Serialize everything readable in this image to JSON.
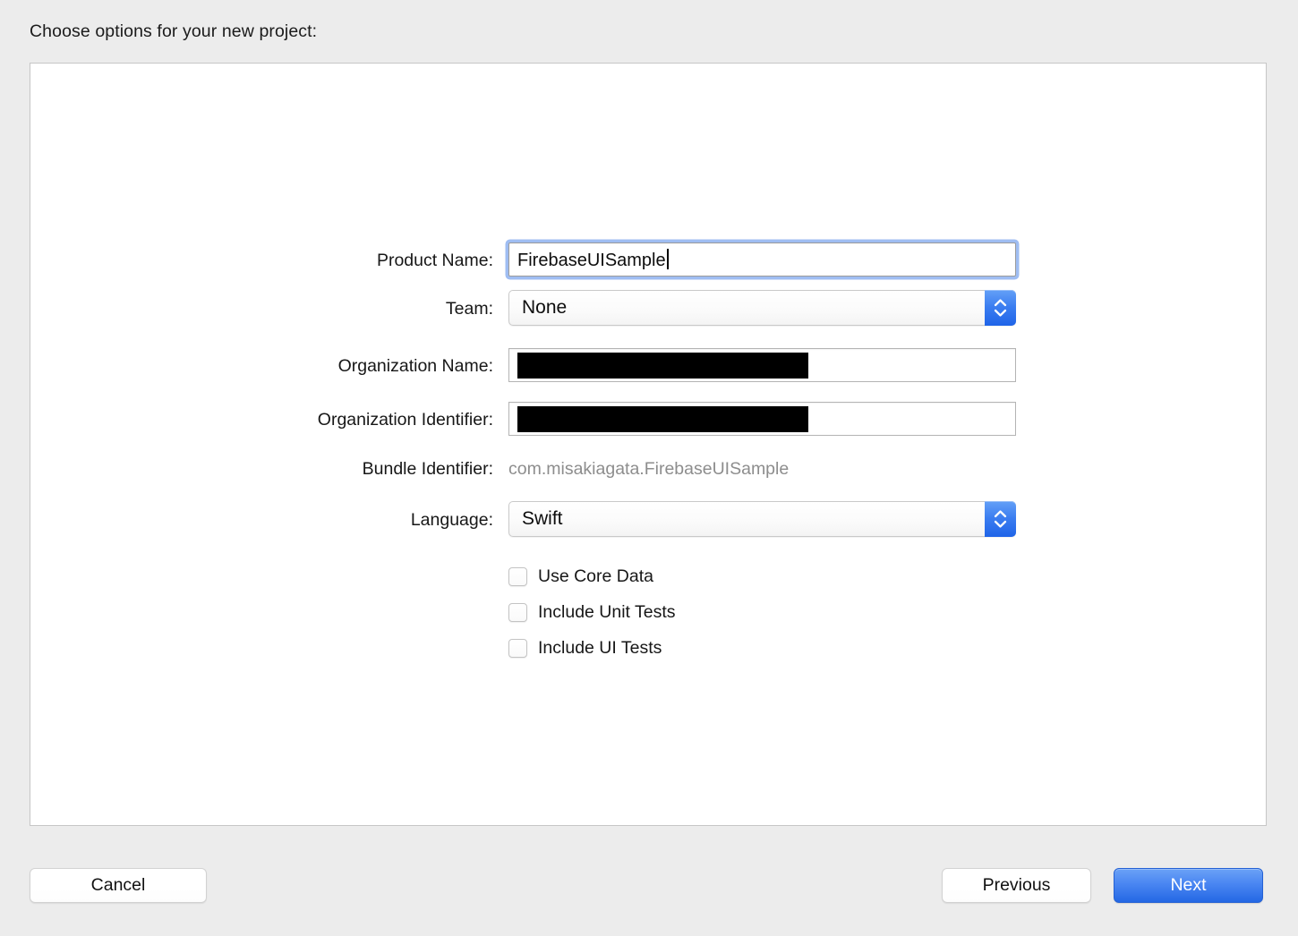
{
  "dialog": {
    "title": "Choose options for your new project:"
  },
  "form": {
    "rows": [
      {
        "label": "Product Name:",
        "type": "text",
        "value": "FirebaseUISample",
        "focused": true
      },
      {
        "label": "Team:",
        "type": "popup",
        "value": "None"
      },
      {
        "label": "Organization Name:",
        "type": "text",
        "value": "",
        "redacted": true
      },
      {
        "label": "Organization Identifier:",
        "type": "text",
        "value": "",
        "redacted": true
      },
      {
        "label": "Bundle Identifier:",
        "type": "static",
        "value": "com.misakiagata.FirebaseUISample"
      },
      {
        "label": "Language:",
        "type": "popup",
        "value": "Swift"
      }
    ],
    "product_name": {
      "label": "Product Name:",
      "value": "FirebaseUISample"
    },
    "team": {
      "label": "Team:",
      "value": "None"
    },
    "organization_name": {
      "label": "Organization Name:",
      "value": ""
    },
    "organization_identifier": {
      "label": "Organization Identifier:",
      "value": ""
    },
    "bundle_identifier": {
      "label": "Bundle Identifier:",
      "value": "com.misakiagata.FirebaseUISample"
    },
    "language": {
      "label": "Language:",
      "value": "Swift"
    }
  },
  "checkboxes": [
    {
      "label": "Use Core Data",
      "checked": false
    },
    {
      "label": "Include Unit Tests",
      "checked": false
    },
    {
      "label": "Include UI Tests",
      "checked": false
    }
  ],
  "buttons": {
    "cancel": "Cancel",
    "previous": "Previous",
    "next": "Next"
  },
  "icons": {
    "stepper": "chevron-up-down-icon"
  },
  "colors": {
    "accent_blue": "#2468e4",
    "focus_ring": "#9fbdf2",
    "window_background": "#ececec",
    "panel_background": "#ffffff",
    "muted_text": "#8d8d8d",
    "redaction": "#000000"
  }
}
